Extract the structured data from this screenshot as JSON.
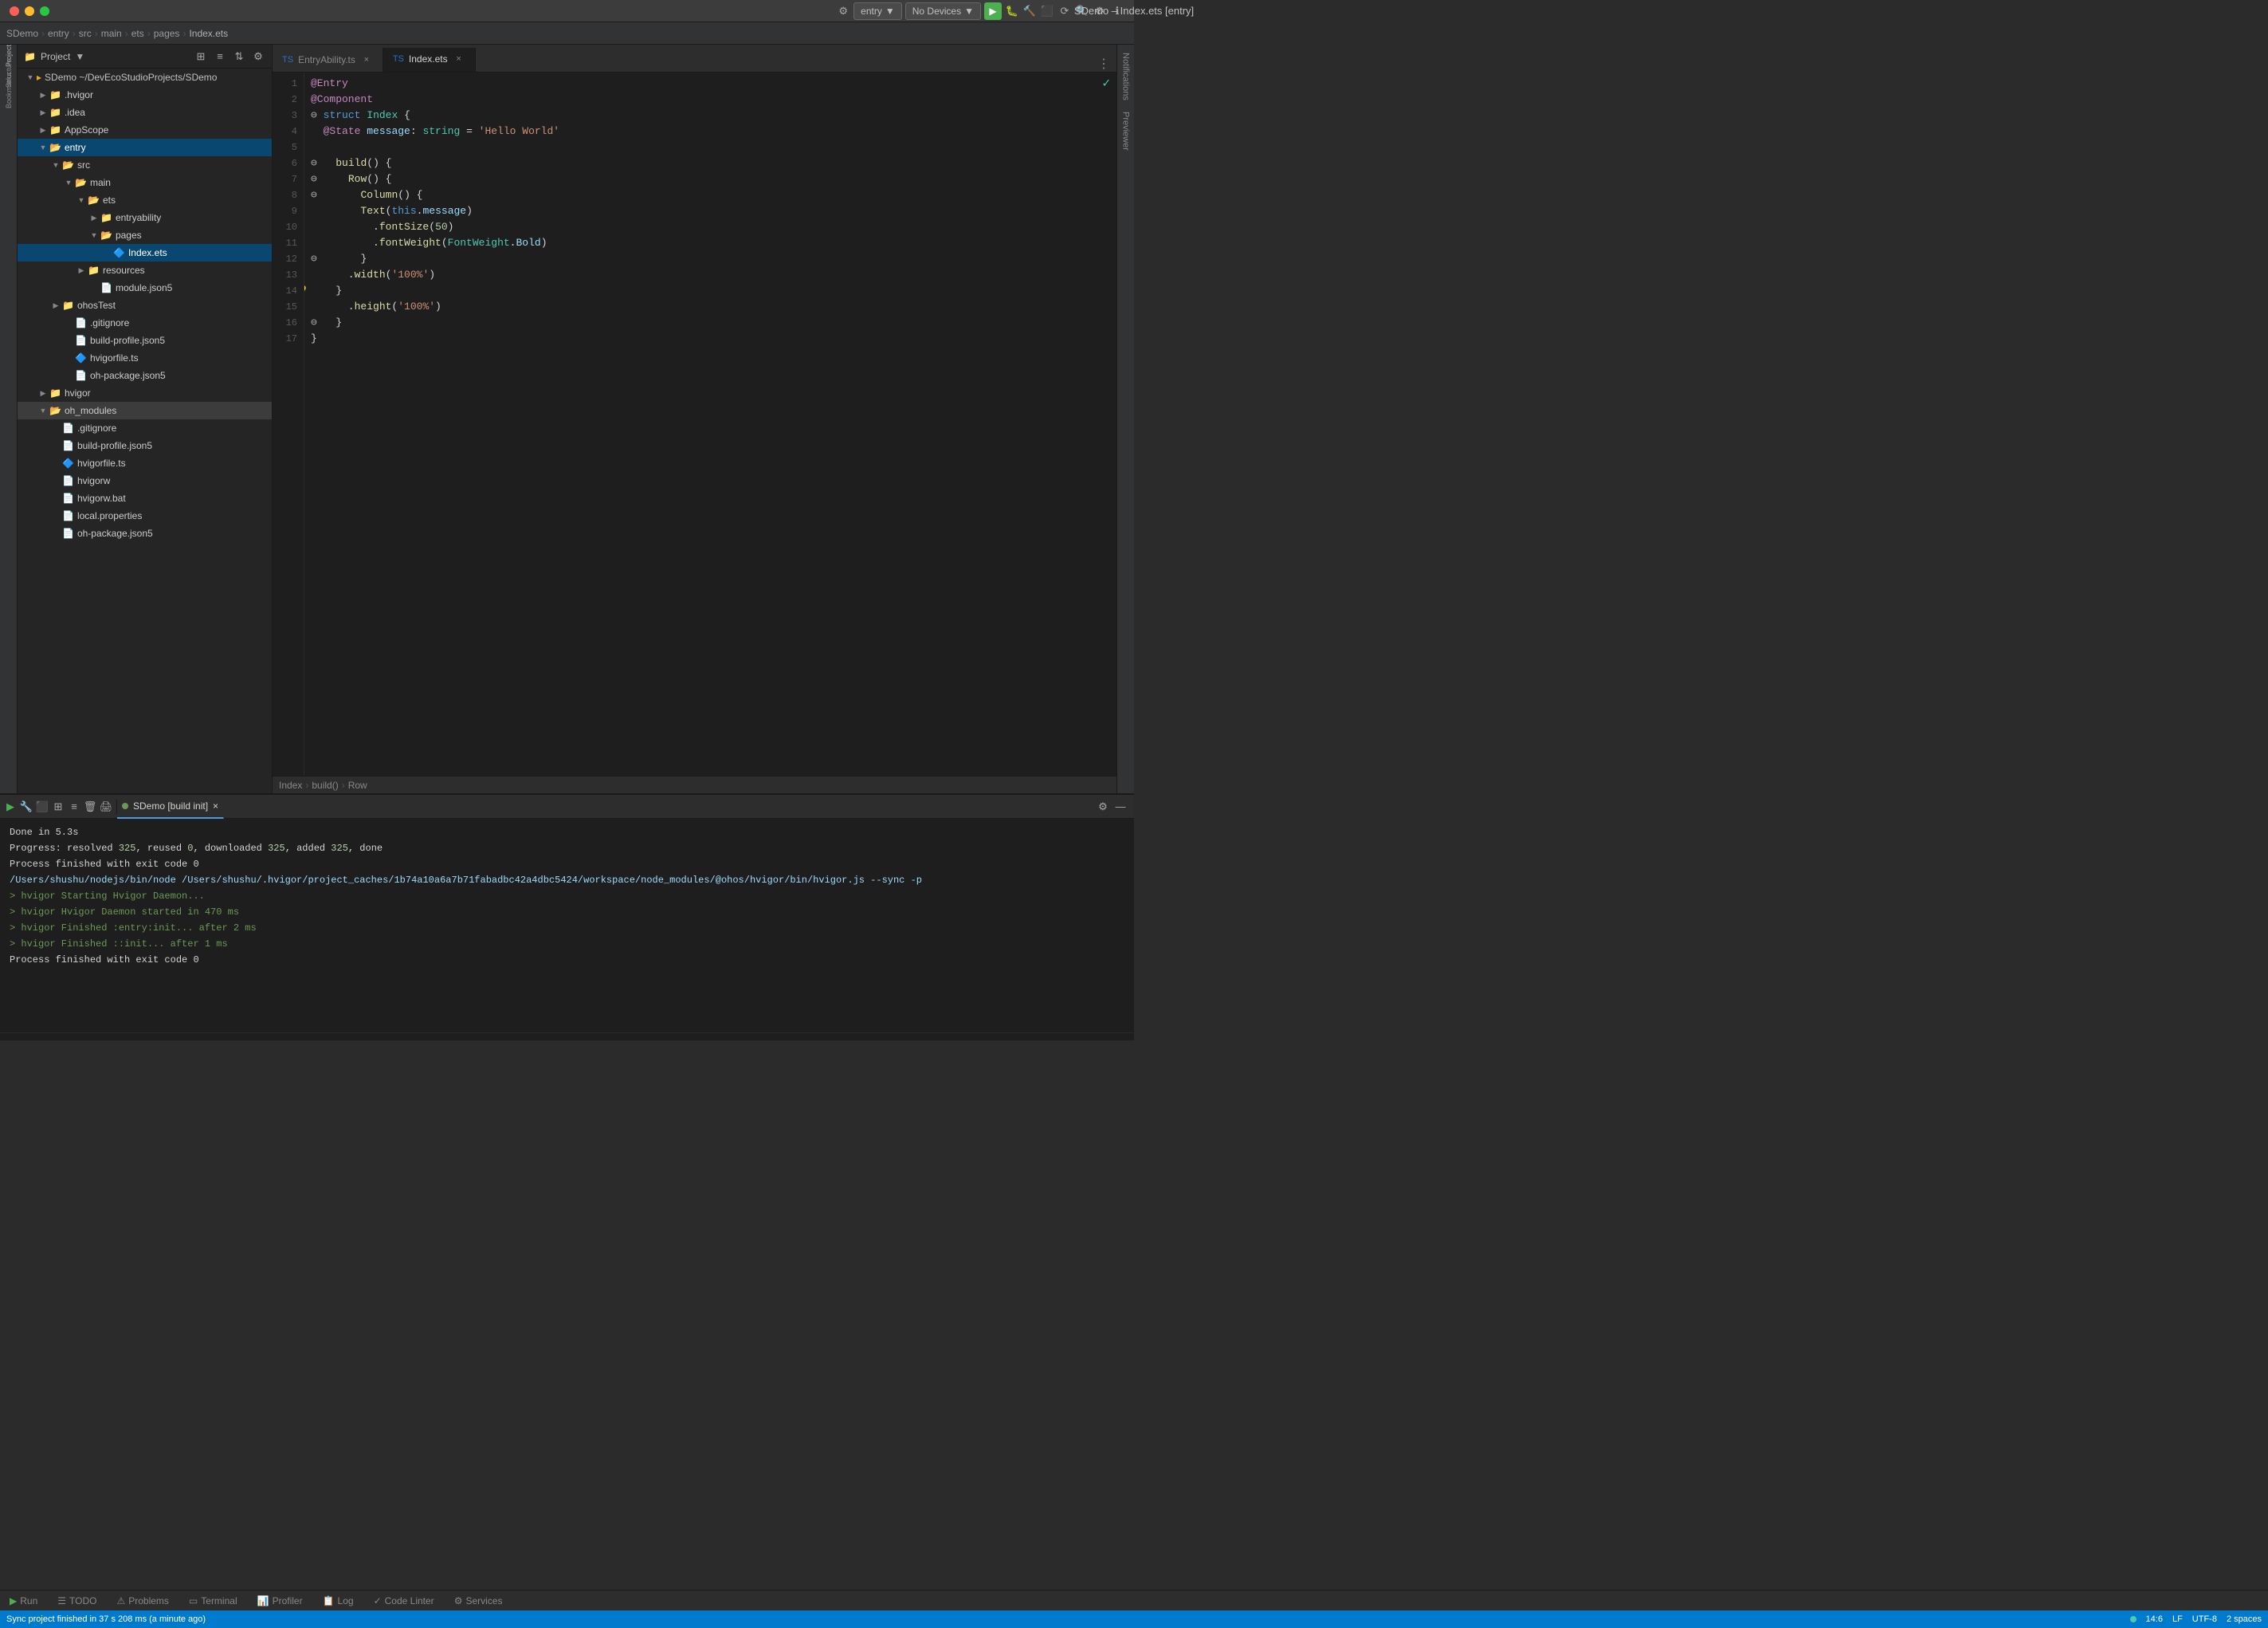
{
  "titleBar": {
    "title": "SDemo – Index.ets [entry]",
    "controls": [
      "close",
      "minimize",
      "maximize"
    ]
  },
  "breadcrumb": {
    "items": [
      "SDemo",
      "entry",
      "src",
      "main",
      "ets",
      "pages",
      "Index.ets"
    ]
  },
  "toolbar": {
    "settingsLabel": "⚙",
    "entryLabel": "entry",
    "noDevicesLabel": "No Devices",
    "playLabel": "▶",
    "searchLabel": "🔍",
    "prefsLabel": "⚙"
  },
  "fileTree": {
    "header": "Project",
    "root": "SDemo ~/DevEcoStudioProjects/SDemo",
    "items": [
      {
        "id": "hvigor",
        "label": ".hvigor",
        "type": "folder",
        "indent": 1,
        "expanded": false
      },
      {
        "id": "idea",
        "label": ".idea",
        "type": "folder",
        "indent": 1,
        "expanded": false
      },
      {
        "id": "appscope",
        "label": "AppScope",
        "type": "folder",
        "indent": 1,
        "expanded": false
      },
      {
        "id": "entry",
        "label": "entry",
        "type": "folder",
        "indent": 1,
        "expanded": true,
        "selected": true
      },
      {
        "id": "src",
        "label": "src",
        "type": "folder",
        "indent": 2,
        "expanded": true
      },
      {
        "id": "main",
        "label": "main",
        "type": "folder",
        "indent": 3,
        "expanded": true
      },
      {
        "id": "ets",
        "label": "ets",
        "type": "folder",
        "indent": 4,
        "expanded": true
      },
      {
        "id": "entryability",
        "label": "entryability",
        "type": "folder",
        "indent": 5,
        "expanded": false
      },
      {
        "id": "pages",
        "label": "pages",
        "type": "folder",
        "indent": 5,
        "expanded": true
      },
      {
        "id": "indexets",
        "label": "Index.ets",
        "type": "ts",
        "indent": 6,
        "selected": true
      },
      {
        "id": "resources",
        "label": "resources",
        "type": "folder",
        "indent": 4,
        "expanded": false
      },
      {
        "id": "modulejson5",
        "label": "module.json5",
        "type": "json",
        "indent": 4
      },
      {
        "id": "ohostest",
        "label": "ohosTest",
        "type": "folder",
        "indent": 2,
        "expanded": false
      },
      {
        "id": "gitignore1",
        "label": ".gitignore",
        "type": "git",
        "indent": 2
      },
      {
        "id": "buildprofile",
        "label": "build-profile.json5",
        "type": "json",
        "indent": 2
      },
      {
        "id": "hvigorfile",
        "label": "hvigorfile.ts",
        "type": "ts",
        "indent": 2
      },
      {
        "id": "ohpackage",
        "label": "oh-package.json5",
        "type": "json",
        "indent": 2
      },
      {
        "id": "hvigordir",
        "label": "hvigor",
        "type": "folder",
        "indent": 1,
        "expanded": false
      },
      {
        "id": "ohmodules",
        "label": "oh_modules",
        "type": "folder",
        "indent": 1,
        "expanded": true,
        "selected2": true
      },
      {
        "id": "gitignore2",
        "label": ".gitignore",
        "type": "git",
        "indent": 2
      },
      {
        "id": "buildprofile2",
        "label": "build-profile.json5",
        "type": "json",
        "indent": 2
      },
      {
        "id": "hvigorfile2",
        "label": "hvigorfile.ts",
        "type": "ts",
        "indent": 2
      },
      {
        "id": "hvigorw",
        "label": "hvigorw",
        "type": "file",
        "indent": 2
      },
      {
        "id": "hvigorwbat",
        "label": "hvigorw.bat",
        "type": "file",
        "indent": 2
      },
      {
        "id": "localprops",
        "label": "local.properties",
        "type": "file",
        "indent": 2
      },
      {
        "id": "ohpackage2",
        "label": "oh-package.json5",
        "type": "json",
        "indent": 2
      }
    ]
  },
  "tabs": {
    "items": [
      {
        "label": "EntryAbility.ts",
        "active": false,
        "icon": "ts"
      },
      {
        "label": "Index.ets",
        "active": true,
        "icon": "ts"
      }
    ]
  },
  "code": {
    "lines": [
      {
        "num": 1,
        "tokens": [
          {
            "t": "kw2",
            "v": "@Entry"
          }
        ]
      },
      {
        "num": 2,
        "tokens": [
          {
            "t": "kw2",
            "v": "@Component"
          }
        ]
      },
      {
        "num": 3,
        "tokens": [
          {
            "t": "kw",
            "v": "struct"
          },
          {
            "t": "plain",
            "v": " "
          },
          {
            "t": "type",
            "v": "Index"
          },
          {
            "t": "plain",
            "v": " {"
          }
        ]
      },
      {
        "num": 4,
        "tokens": [
          {
            "t": "plain",
            "v": "  "
          },
          {
            "t": "kw2",
            "v": "@State"
          },
          {
            "t": "plain",
            "v": " "
          },
          {
            "t": "prop",
            "v": "message"
          },
          {
            "t": "plain",
            "v": ": "
          },
          {
            "t": "type",
            "v": "string"
          },
          {
            "t": "plain",
            "v": " = "
          },
          {
            "t": "str",
            "v": "'Hello World'"
          }
        ]
      },
      {
        "num": 5,
        "tokens": [
          {
            "t": "plain",
            "v": ""
          }
        ]
      },
      {
        "num": 6,
        "tokens": [
          {
            "t": "plain",
            "v": "  "
          },
          {
            "t": "fn",
            "v": "build"
          },
          {
            "t": "plain",
            "v": "() {"
          }
        ]
      },
      {
        "num": 7,
        "tokens": [
          {
            "t": "plain",
            "v": "    "
          },
          {
            "t": "fn",
            "v": "Row"
          },
          {
            "t": "plain",
            "v": "() {"
          }
        ]
      },
      {
        "num": 8,
        "tokens": [
          {
            "t": "plain",
            "v": "      "
          },
          {
            "t": "fn",
            "v": "Column"
          },
          {
            "t": "plain",
            "v": "() {"
          }
        ]
      },
      {
        "num": 9,
        "tokens": [
          {
            "t": "plain",
            "v": "        "
          },
          {
            "t": "fn",
            "v": "Text"
          },
          {
            "t": "plain",
            "v": "("
          },
          {
            "t": "kw",
            "v": "this"
          },
          {
            "t": "plain",
            "v": "."
          },
          {
            "t": "prop",
            "v": "message"
          },
          {
            "t": "plain",
            "v": ")"
          }
        ]
      },
      {
        "num": 10,
        "tokens": [
          {
            "t": "plain",
            "v": "          ."
          },
          {
            "t": "fn",
            "v": "fontSize"
          },
          {
            "t": "plain",
            "v": "("
          },
          {
            "t": "num",
            "v": "50"
          },
          {
            "t": "plain",
            "v": ")"
          }
        ]
      },
      {
        "num": 11,
        "tokens": [
          {
            "t": "plain",
            "v": "          ."
          },
          {
            "t": "fn",
            "v": "fontWeight"
          },
          {
            "t": "plain",
            "v": "("
          },
          {
            "t": "type",
            "v": "FontWeight"
          },
          {
            "t": "plain",
            "v": "."
          },
          {
            "t": "prop",
            "v": "Bold"
          },
          {
            "t": "plain",
            "v": ")"
          }
        ]
      },
      {
        "num": 12,
        "tokens": [
          {
            "t": "plain",
            "v": "      }"
          }
        ]
      },
      {
        "num": 13,
        "tokens": [
          {
            "t": "plain",
            "v": "      ."
          },
          {
            "t": "fn",
            "v": "width"
          },
          {
            "t": "plain",
            "v": "("
          },
          {
            "t": "str",
            "v": "'100%'"
          },
          {
            "t": "plain",
            "v": ")"
          }
        ]
      },
      {
        "num": 14,
        "tokens": [
          {
            "t": "plain",
            "v": "    }"
          }
        ],
        "hint": true
      },
      {
        "num": 15,
        "tokens": [
          {
            "t": "plain",
            "v": "      ."
          },
          {
            "t": "fn",
            "v": "height"
          },
          {
            "t": "plain",
            "v": "("
          },
          {
            "t": "str",
            "v": "'100%'"
          },
          {
            "t": "plain",
            "v": ")"
          }
        ]
      },
      {
        "num": 16,
        "tokens": [
          {
            "t": "plain",
            "v": "  }"
          }
        ]
      },
      {
        "num": 17,
        "tokens": [
          {
            "t": "plain",
            "v": "}"
          }
        ]
      }
    ]
  },
  "editorBreadcrumb": {
    "items": [
      "Index",
      "build()",
      "Row"
    ]
  },
  "console": {
    "runLabel": "SDemo [build init]",
    "output": [
      {
        "text": "Done in 5.3s",
        "color": "plain"
      },
      {
        "text": "Progress: resolved 325, reused 0, downloaded 325, added 325, done",
        "color": "mixed"
      },
      {
        "text": "",
        "color": "plain"
      },
      {
        "text": "Process finished with exit code 0",
        "color": "plain"
      },
      {
        "text": "/Users/shushu/nodejs/bin/node /Users/shushu/.hvigor/project_caches/1b74a10a6a7b71fabadbc42a4dbc5424/workspace/node_modules/@ohos/hvigor/bin/hvigor.js --sync -p",
        "color": "path"
      },
      {
        "text": "> hvigor Starting Hvigor Daemon...",
        "color": "green"
      },
      {
        "text": "> hvigor Hvigor Daemon started in 470 ms",
        "color": "green"
      },
      {
        "text": "> hvigor Finished :entry:init... after 2 ms",
        "color": "green"
      },
      {
        "text": "> hvigor Finished ::init... after 1 ms",
        "color": "green"
      },
      {
        "text": "",
        "color": "plain"
      },
      {
        "text": "Process finished with exit code 0",
        "color": "plain"
      }
    ]
  },
  "bottomTabs": [
    {
      "label": "Run",
      "icon": "▶",
      "active": false
    },
    {
      "label": "TODO",
      "icon": "☰",
      "active": false
    },
    {
      "label": "Problems",
      "icon": "⚠",
      "active": false
    },
    {
      "label": "Terminal",
      "icon": "▭",
      "active": false
    },
    {
      "label": "Profiler",
      "icon": "📊",
      "active": false
    },
    {
      "label": "Log",
      "icon": "📋",
      "active": false
    },
    {
      "label": "Code Linter",
      "icon": "✓",
      "active": false
    },
    {
      "label": "Services",
      "icon": "⚙",
      "active": false
    }
  ],
  "statusBar": {
    "leftText": "Sync project finished in 37 s 208 ms (a minute ago)",
    "position": "14:6",
    "encoding": "UTF-8",
    "indent": "2 spaces",
    "lineEnding": "LF"
  }
}
